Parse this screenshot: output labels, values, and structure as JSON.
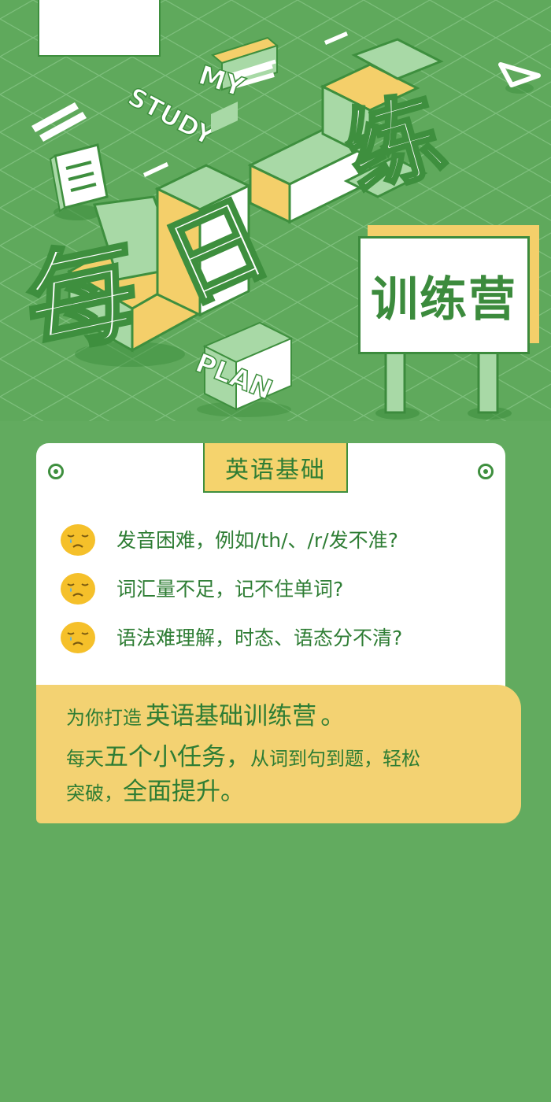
{
  "hero": {
    "title_chars": [
      "每",
      "日",
      "一",
      "练"
    ],
    "tag_my": "MY",
    "tag_study": "STUDY",
    "tag_plan": "PLAN",
    "sign_text": "训练营",
    "colors": {
      "background": "#5fa95c",
      "grid": "#8cc88a",
      "block_top": "#a8d9a6",
      "block_side": "#f4cf6a",
      "white": "#ffffff",
      "dark_green": "#3c8b3d"
    },
    "icons": [
      "book-icon",
      "triangle-icon",
      "stripes-icon",
      "signpost-icon"
    ]
  },
  "card": {
    "tab_label": "英语基础",
    "questions": [
      {
        "icon": "sad-face-icon",
        "text": "发音困难，例如/th/、/r/发不准?"
      },
      {
        "icon": "sad-face-icon",
        "text": "词汇量不足，记不住单词?"
      },
      {
        "icon": "sad-face-icon",
        "text": "语法难理解，时态、语态分不清?"
      }
    ]
  },
  "promo": {
    "line1_prefix": "为你打造",
    "line1_highlight": "英语基础训练营",
    "line1_suffix": "。",
    "line2_prefix": "每天",
    "line2_highlight": "五个小任务，",
    "line2_suffix": "从词到句到题，轻松",
    "line3_prefix": "突破，",
    "line3_highlight": "全面提升。"
  },
  "theme": {
    "page_bg": "#62ab5f",
    "accent_yellow": "#f3d272",
    "text_green": "#2e7d34"
  }
}
